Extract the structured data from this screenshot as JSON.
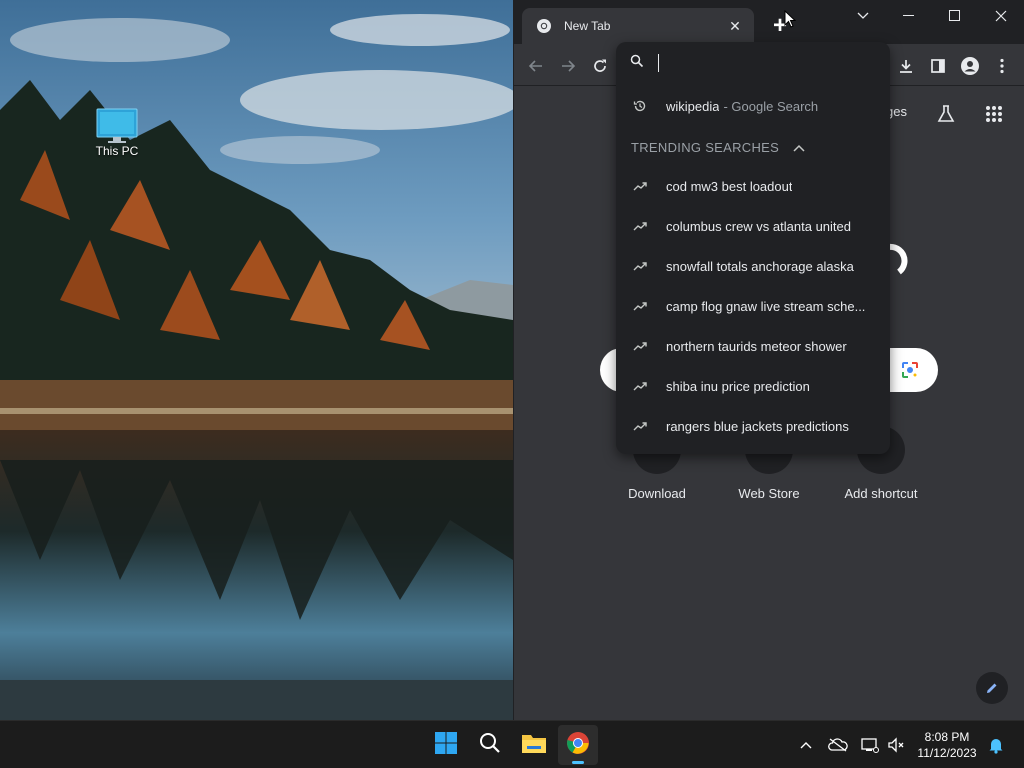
{
  "desktop": {
    "icons": [
      {
        "label": "This PC",
        "icon": "this-pc-icon"
      }
    ]
  },
  "browser": {
    "tab": {
      "title": "New Tab",
      "favicon": "chrome-icon"
    },
    "ntp": {
      "links": {
        "images": "ges"
      },
      "shortcuts": [
        {
          "label": "Download"
        },
        {
          "label": "Web Store"
        },
        {
          "label": "Add shortcut"
        }
      ]
    }
  },
  "omnibox": {
    "value": "",
    "history_suggestion": {
      "text": "wikipedia",
      "suffix": "- Google Search"
    },
    "trending_header": "TRENDING SEARCHES",
    "trending": [
      "cod mw3 best loadout",
      "columbus crew vs atlanta united",
      "snowfall totals anchorage alaska",
      "camp flog gnaw live stream sche...",
      "northern taurids meteor shower",
      "shiba inu price prediction",
      "rangers blue jackets predictions"
    ]
  },
  "taskbar": {
    "apps": [
      "start-icon",
      "search-icon",
      "file-explorer-icon",
      "chrome-icon"
    ],
    "clock": {
      "time": "8:08 PM",
      "date": "11/12/2023"
    }
  },
  "colors": {
    "accent": "#4cc2ff",
    "browser_bg": "#35363a",
    "dropdown_bg": "#202124",
    "text": "#e8eaed",
    "muted": "#9aa0a6"
  }
}
